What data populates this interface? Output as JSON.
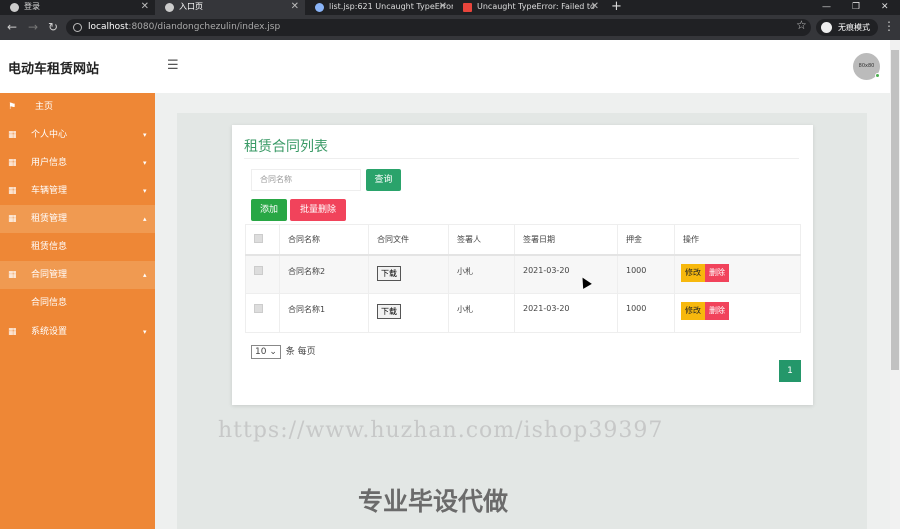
{
  "browser": {
    "tabs": [
      {
        "title": "登录"
      },
      {
        "title": "入口页"
      },
      {
        "title": "list.jsp:621 Uncaught TypeError:"
      },
      {
        "title": "Uncaught TypeError: Failed to"
      }
    ],
    "url_host": "localhost",
    "url_rest": ":8080/diandongchezulin/index.jsp",
    "incognito_label": "无痕模式"
  },
  "header": {
    "brand": "电动车租赁网站",
    "avatar_text": "80x80"
  },
  "sidebar": {
    "items": [
      {
        "label": "主页",
        "icon": "flag-icon"
      },
      {
        "label": "个人中心",
        "icon": "grid-icon"
      },
      {
        "label": "用户信息",
        "icon": "grid-icon"
      },
      {
        "label": "车辆管理",
        "icon": "grid-icon"
      },
      {
        "label": "租赁管理",
        "icon": "grid-icon"
      },
      {
        "label": "租赁信息"
      },
      {
        "label": "合同管理",
        "icon": "grid-icon"
      },
      {
        "label": "合同信息"
      },
      {
        "label": "系统设置",
        "icon": "grid-icon"
      }
    ]
  },
  "main": {
    "title": "租赁合同列表",
    "search_placeholder": "合同名称",
    "query_label": "查询",
    "add_label": "添加",
    "batch_delete_label": "批量删除",
    "columns": [
      "合同名称",
      "合同文件",
      "签署人",
      "签署日期",
      "押金",
      "操作"
    ],
    "rows": [
      {
        "name": "合同名称2",
        "file_btn": "下载",
        "signer": "小札",
        "date": "2021-03-20",
        "deposit": "1000",
        "edit": "修改",
        "delete": "删除"
      },
      {
        "name": "合同名称1",
        "file_btn": "下载",
        "signer": "小札",
        "date": "2021-03-20",
        "deposit": "1000",
        "edit": "修改",
        "delete": "删除"
      }
    ],
    "page_size": "10",
    "page_size_suffix": "条 每页",
    "current_page": "1"
  },
  "watermark": {
    "url": "https://www.huzhan.com/ishop39397",
    "text": "专业毕设代做"
  }
}
